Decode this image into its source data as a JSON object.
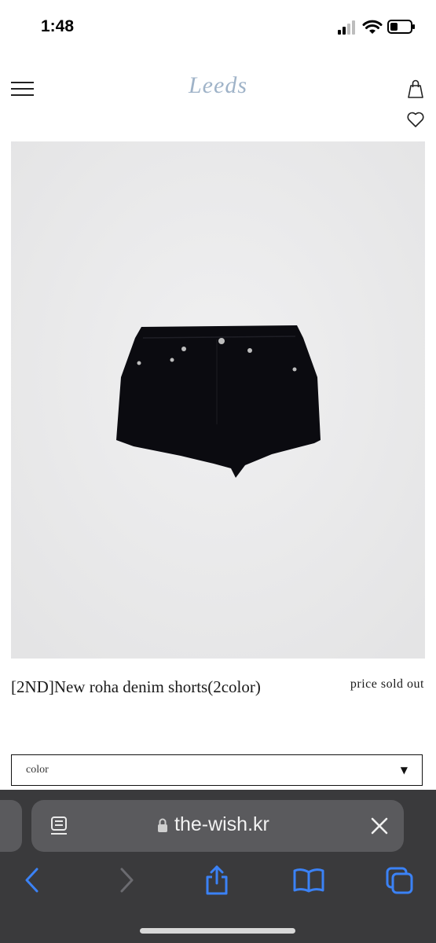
{
  "status_bar": {
    "time": "1:48"
  },
  "header": {
    "logo": "Leeds"
  },
  "product": {
    "title": "[2ND]New roha denim shorts(2color)",
    "price": "price sold out"
  },
  "options": {
    "color_select_label": "color",
    "arrow": "▼"
  },
  "browser": {
    "url": "the-wish.kr"
  },
  "icons": {
    "menu": "hamburger-menu-icon",
    "bag": "shopping-bag-icon",
    "heart": "heart-icon",
    "reader": "reader-icon",
    "lock": "lock-icon",
    "clear": "close-icon",
    "back": "back-arrow-icon",
    "forward": "forward-arrow-icon",
    "share": "share-icon",
    "bookmarks": "book-icon",
    "tabs": "tabs-icon"
  },
  "colors": {
    "accent": "#3b82f6",
    "logo": "#9fb3c8",
    "browser_bg": "#3a3a3c"
  }
}
